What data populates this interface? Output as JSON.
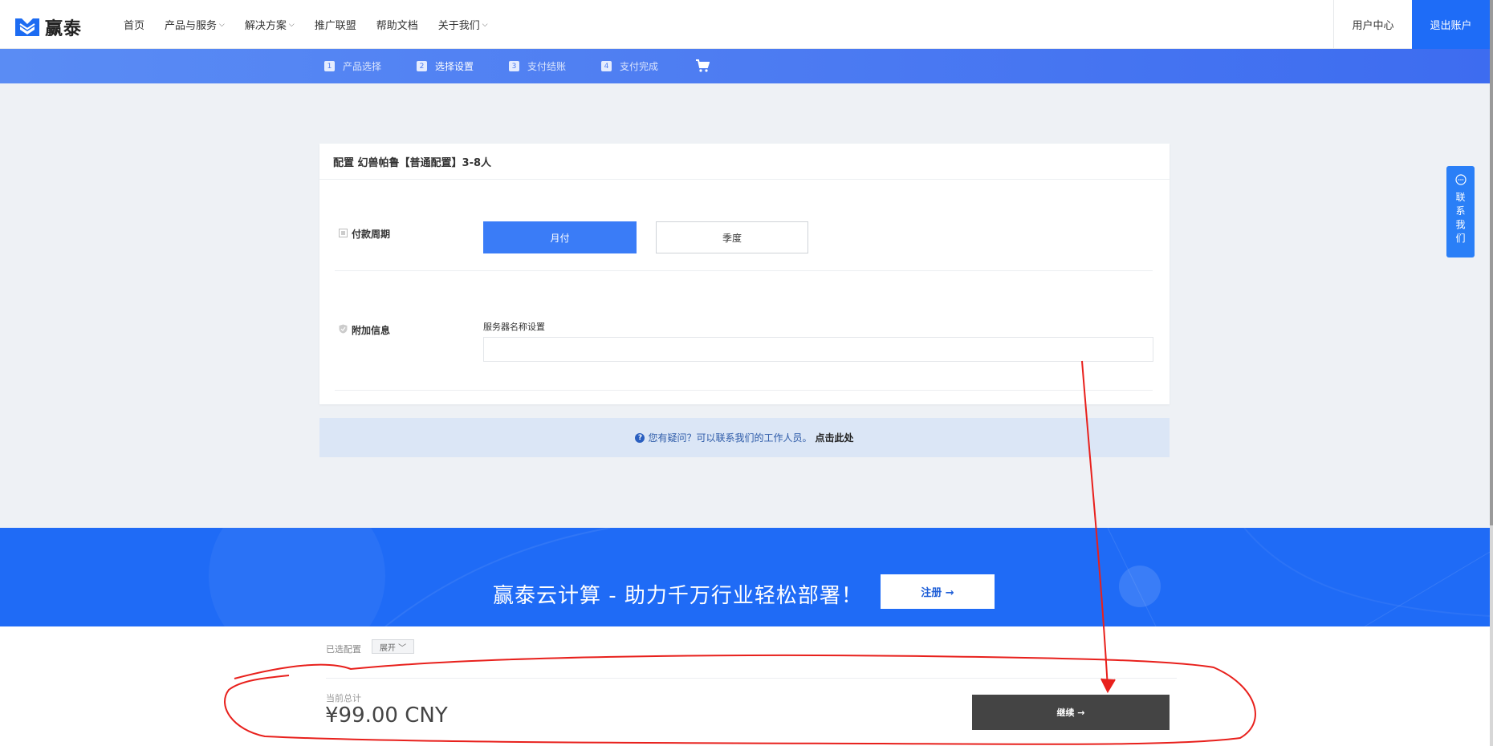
{
  "header": {
    "logo_text": "赢泰",
    "nav": [
      {
        "label": "首页",
        "dropdown": false
      },
      {
        "label": "产品与服务",
        "dropdown": true
      },
      {
        "label": "解决方案",
        "dropdown": true
      },
      {
        "label": "推广联盟",
        "dropdown": false
      },
      {
        "label": "帮助文档",
        "dropdown": false
      },
      {
        "label": "关于我们",
        "dropdown": true
      }
    ],
    "user_center": "用户中心",
    "logout": "退出账户"
  },
  "steps": [
    {
      "num": "1",
      "label": "产品选择"
    },
    {
      "num": "2",
      "label": "选择设置"
    },
    {
      "num": "3",
      "label": "支付结账"
    },
    {
      "num": "4",
      "label": "支付完成"
    }
  ],
  "contact": {
    "chars": [
      "联",
      "系",
      "我",
      "们"
    ]
  },
  "card": {
    "title": "配置 幻兽帕鲁【普通配置】3-8人",
    "payment_cycle_label": "付款周期",
    "option_month": "月付",
    "option_quarter": "季度",
    "extra_info_label": "附加信息",
    "server_name_label": "服务器名称设置",
    "server_name_value": ""
  },
  "help": {
    "text": "您有疑问？可以联系我们的工作人员。",
    "link": "点击此处"
  },
  "banner": {
    "text": "赢泰云计算 - 助力千万行业轻松部署！",
    "button": "注册 →"
  },
  "bottom": {
    "selected_label": "已选配置",
    "expand_label": "展开 ﹀",
    "total_label": "当前总计",
    "total_value": "¥99.00 CNY",
    "continue_label": "继续 →"
  },
  "colors": {
    "brand": "#1e6cf7",
    "steps_bar": "#4d7cf2",
    "continue": "#444444",
    "annotation": "#e8201c"
  }
}
